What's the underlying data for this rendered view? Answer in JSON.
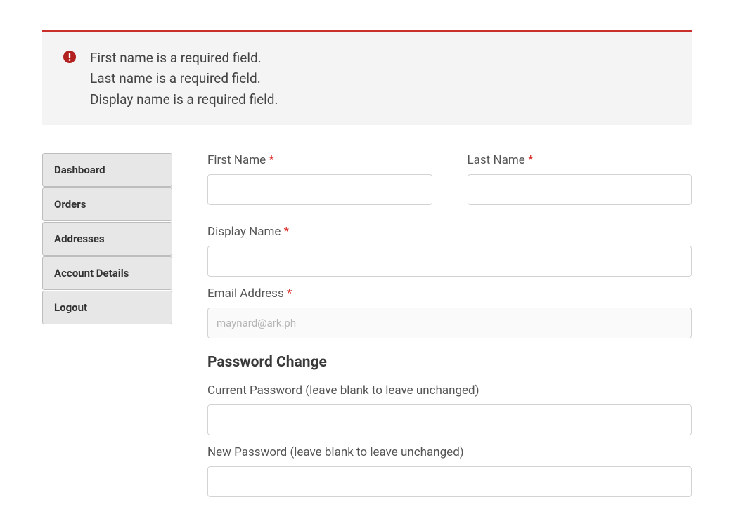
{
  "alert": {
    "messages": [
      "First name is a required field.",
      "Last name is a required field.",
      "Display name is a required field."
    ]
  },
  "sidebar": {
    "items": [
      {
        "label": "Dashboard"
      },
      {
        "label": "Orders"
      },
      {
        "label": "Addresses"
      },
      {
        "label": "Account Details"
      },
      {
        "label": "Logout"
      }
    ]
  },
  "form": {
    "first_name": {
      "label": "First Name",
      "value": ""
    },
    "last_name": {
      "label": "Last Name",
      "value": ""
    },
    "display_name": {
      "label": "Display Name",
      "value": ""
    },
    "email": {
      "label": "Email Address",
      "value": "maynard@ark.ph"
    },
    "password_section_heading": "Password Change",
    "current_password": {
      "label": "Current Password (leave blank to leave unchanged)",
      "value": ""
    },
    "new_password": {
      "label": "New Password (leave blank to leave unchanged)",
      "value": ""
    }
  },
  "colors": {
    "accent": "#c9302c"
  }
}
